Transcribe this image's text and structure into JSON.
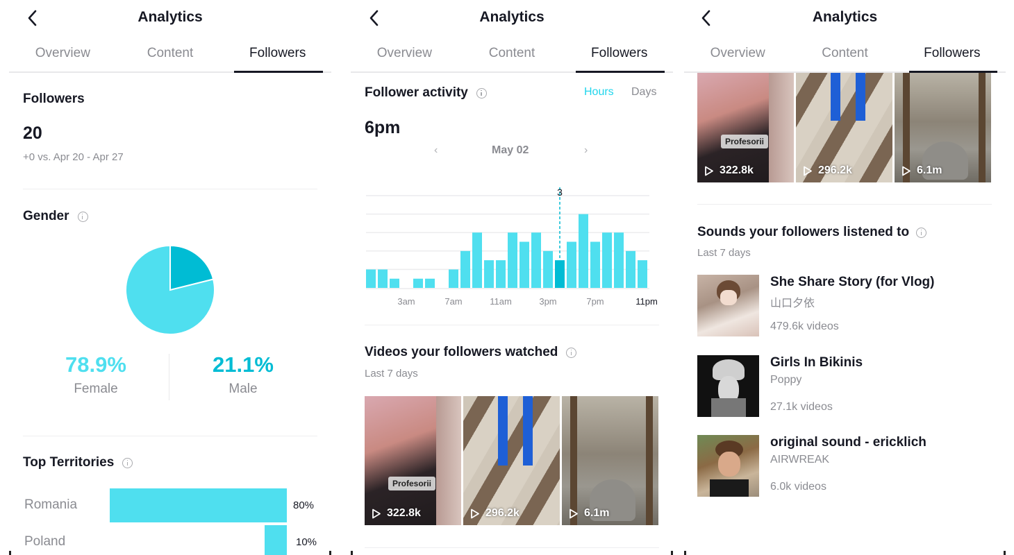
{
  "app": {
    "title": "Analytics",
    "tabs": [
      {
        "label": "Overview",
        "active": false
      },
      {
        "label": "Content",
        "active": false
      },
      {
        "label": "Followers",
        "active": true
      }
    ]
  },
  "colors": {
    "accent": "#20d5ec",
    "female": "#4fdfef",
    "male": "#00bcd4",
    "text": "#161823",
    "muted": "#8a8b91"
  },
  "followers": {
    "heading": "Followers",
    "count": "20",
    "comparison": "+0 vs. Apr 20 - Apr 27"
  },
  "gender": {
    "heading": "Gender",
    "info_icon": "info-icon",
    "female_pct": "78.9%",
    "female_label": "Female",
    "male_pct": "21.1%",
    "male_label": "Male"
  },
  "territories": {
    "heading": "Top Territories",
    "items": [
      {
        "name": "Romania",
        "pct_label": "80%",
        "value": 80
      },
      {
        "name": "Poland",
        "pct_label": "10%",
        "value": 10
      }
    ]
  },
  "activity": {
    "heading": "Follower activity",
    "toggle_hours": "Hours",
    "toggle_days": "Days",
    "selected_time": "6pm",
    "date": "May 02",
    "prev_icon": "chevron-left-icon",
    "next_icon": "chevron-right-icon"
  },
  "chart_data": [
    {
      "type": "pie",
      "title": "Gender",
      "labels": [
        "Female",
        "Male"
      ],
      "values": [
        78.9,
        21.1
      ]
    },
    {
      "type": "bar",
      "title": "Top Territories",
      "categories": [
        "Romania",
        "Poland"
      ],
      "values": [
        80,
        10
      ],
      "orientation": "horizontal"
    },
    {
      "type": "bar",
      "title": "Follower activity",
      "xlabel": "",
      "ylabel": "",
      "ylim": [
        0,
        10
      ],
      "grid": true,
      "x": [
        "12am",
        "1am",
        "2am",
        "3am",
        "4am",
        "5am",
        "6am",
        "7am",
        "8am",
        "9am",
        "10am",
        "11am",
        "12pm",
        "1pm",
        "2pm",
        "3pm",
        "4pm",
        "5pm",
        "6pm",
        "7pm",
        "8pm",
        "9pm",
        "10pm",
        "11pm"
      ],
      "values": [
        2,
        2,
        1,
        0,
        1,
        1,
        0,
        2,
        4,
        6,
        3,
        3,
        6,
        5,
        6,
        4,
        3,
        5,
        8,
        5,
        6,
        6,
        4,
        3
      ],
      "selected_index": 16,
      "selected_label": "3",
      "tick_labels": [
        "3am",
        "7am",
        "11am",
        "3pm",
        "7pm",
        "11pm"
      ]
    }
  ],
  "videos": {
    "heading": "Videos your followers watched",
    "subtitle": "Last 7 days",
    "items": [
      {
        "views": "322.8k",
        "tag": "Profesorii"
      },
      {
        "views": "296.2k",
        "tag": ""
      },
      {
        "views": "6.1m",
        "tag": ""
      }
    ]
  },
  "sounds": {
    "heading": "Sounds your followers listened to",
    "subtitle": "Last 7 days",
    "items": [
      {
        "name": "She Share Story (for Vlog)",
        "artist": "山口夕依",
        "count": "479.6k videos"
      },
      {
        "name": "Girls In Bikinis",
        "artist": "Poppy",
        "count": "27.1k videos"
      },
      {
        "name": "original sound - ericklich",
        "artist": "AIRWREAK",
        "count": "6.0k videos"
      }
    ]
  }
}
